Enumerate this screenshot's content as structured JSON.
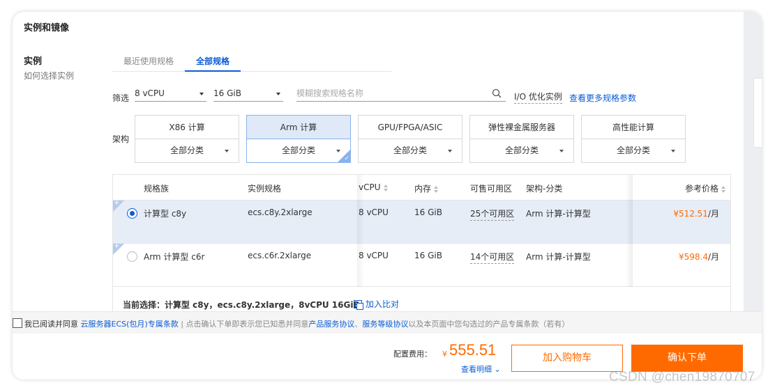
{
  "section": {
    "title": "实例和镜像"
  },
  "instance": {
    "label": "实例",
    "help_link": "如何选择实例"
  },
  "tabs": [
    {
      "label": "最近使用规格",
      "active": false
    },
    {
      "label": "全部规格",
      "active": true
    }
  ],
  "filter": {
    "label": "筛选",
    "vcpu": "8 vCPU",
    "memory": "16 GiB",
    "search_placeholder": "模糊搜索规格名称",
    "io_optimized": "I/O 优化实例",
    "more_link": "查看更多规格参数"
  },
  "arch": {
    "label": "架构",
    "items": [
      {
        "name": "X86 计算",
        "sub": "全部分类",
        "active": false
      },
      {
        "name": "Arm 计算",
        "sub": "全部分类",
        "active": true
      },
      {
        "name": "GPU/FPGA/ASIC",
        "sub": "全部分类",
        "active": false
      },
      {
        "name": "弹性裸金属服务器",
        "sub": "全部分类",
        "active": false
      },
      {
        "name": "高性能计算",
        "sub": "全部分类",
        "active": false
      }
    ]
  },
  "table": {
    "headers": {
      "family": "规格族",
      "spec": "实例规格",
      "vcpu": "vCPU",
      "memory": "内存",
      "zones": "可售可用区",
      "arch": "架构-分类",
      "price": "参考价格"
    },
    "rows": [
      {
        "family": "计算型 c8y",
        "spec": "ecs.c8y.2xlarge",
        "vcpu": "8 vCPU",
        "memory": "16 GiB",
        "zones": "25个可用区",
        "arch": "Arm 计算-计算型",
        "price_currency": "¥",
        "price_amount": "512.51",
        "price_unit": "/月",
        "selected": true
      },
      {
        "family": "Arm 计算型 c6r",
        "spec": "ecs.c6r.2xlarge",
        "vcpu": "8 vCPU",
        "memory": "16 GiB",
        "zones": "14个可用区",
        "arch": "Arm 计算-计算型",
        "price_currency": "¥",
        "price_amount": "598.4",
        "price_unit": "/月",
        "selected": false
      }
    ],
    "summary": "当前选择：计算型 c8y，ecs.c8y.2xlarge，8vCPU 16GiB",
    "compare": "加入比对"
  },
  "agreement": {
    "prefix": "我已阅读并同意",
    "link": "云服务器ECS(包月)专属条款",
    "sep": "|",
    "note": "点击确认下单即表示您已知悉并同意",
    "link2": "产品服务协议",
    "comma": "、",
    "link3": "服务等级协议",
    "suffix": "以及本页面中您勾选过的产品专属条款（若有）"
  },
  "footer": {
    "fee_label": "配置费用：",
    "currency": "¥",
    "amount": "555.51",
    "detail": "查看明细",
    "cart": "加入购物车",
    "order": "确认下单"
  },
  "watermark": "CSDN @chen19870707",
  "colors": {
    "accent": "#0b5cd5",
    "orange": "#ff6a00",
    "selected_row": "#e6edf7"
  }
}
